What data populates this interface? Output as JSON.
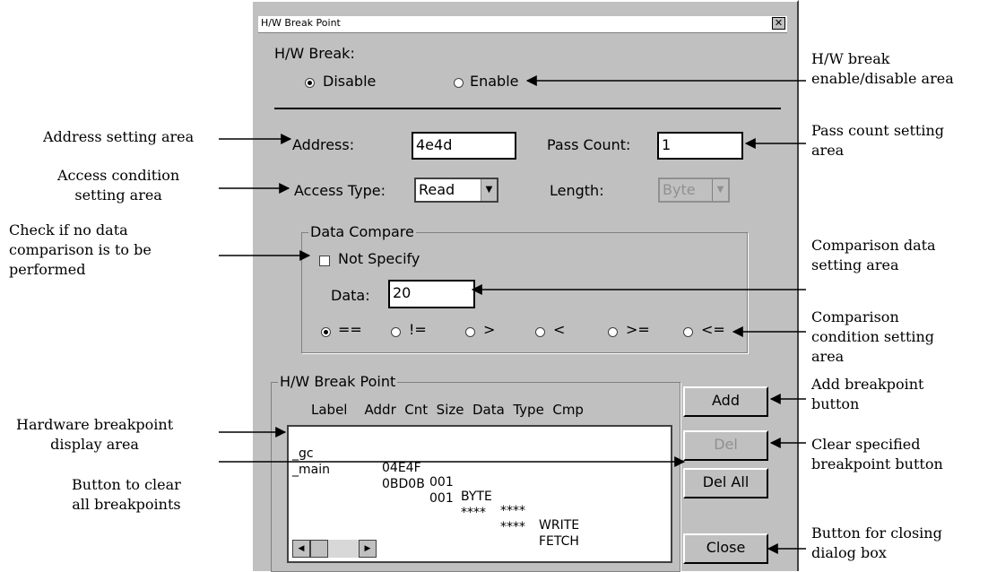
{
  "dialog": {
    "title": "H/W Break Point",
    "close_glyph": "✕",
    "hw_break_label": "H/W Break:",
    "mode_options": [
      "Disable",
      "Enable"
    ],
    "selected_mode": "Disable",
    "address_label": "Address:",
    "address_value": "4e4d",
    "pass_count_label": "Pass Count:",
    "pass_count_value": "1",
    "access_type_label": "Access Type:",
    "access_type_value": "Read",
    "length_label": "Length:",
    "length_value": "Byte",
    "data_compare": {
      "title": "Data Compare",
      "not_specify_label": "Not Specify",
      "not_specify_checked": false,
      "data_label": "Data:",
      "data_value": "20",
      "operators": [
        "==",
        "!=",
        ">",
        "<",
        ">=",
        "<="
      ],
      "selected_operator": "=="
    },
    "breakpoints": {
      "title": "H/W Break Point",
      "header": "Label    Addr  Cnt  Size  Data  Type  Cmp",
      "rows": [
        {
          "label": "_gc",
          "addr": "04E4F",
          "cnt": "001",
          "size": "BYTE",
          "data": "****",
          "type": "WRITE"
        },
        {
          "label": "_main",
          "addr": "0BD0B",
          "cnt": "001",
          "size": "****",
          "data": "****",
          "type": "FETCH"
        }
      ]
    },
    "buttons": {
      "add": "Add",
      "del": "Del",
      "del_all": "Del All",
      "close": "Close"
    },
    "icons": {
      "close": "close-icon",
      "scroll_left": "arrow-left-icon",
      "scroll_right": "arrow-right-icon",
      "dropdown": "chevron-down-icon"
    }
  },
  "annotations": {
    "hw_break": [
      "H/W break",
      "enable/disable area"
    ],
    "pass_count": [
      "Pass count setting",
      "area"
    ],
    "comparison_data": [
      "Comparison data",
      "setting area"
    ],
    "comparison_condition": [
      "Comparison",
      "condition setting",
      "area"
    ],
    "add_button": [
      "Add breakpoint",
      "button"
    ],
    "clear_specified": [
      "Clear specified",
      "breakpoint button"
    ],
    "closing": [
      "Button for closing",
      "dialog box"
    ],
    "address": [
      "Address setting area"
    ],
    "access_condition": [
      "Access condition",
      "setting area"
    ],
    "no_data_compare": [
      "Check if no data",
      "comparison is to be",
      "performed"
    ],
    "breakpoint_display": [
      "Hardware breakpoint",
      "display area"
    ],
    "clear_all": [
      "Button to clear",
      "all breakpoints"
    ]
  }
}
